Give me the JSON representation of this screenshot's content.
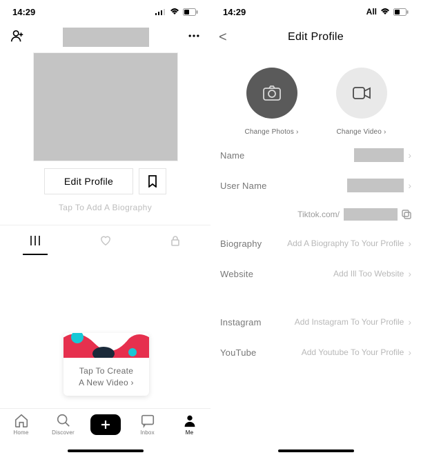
{
  "status": {
    "time": "14:29",
    "right_carrier": "All"
  },
  "left": {
    "edit_profile_btn": "Edit Profile",
    "bio_placeholder": "Tap To Add A Biography",
    "popup_line1": "Tap To Create",
    "popup_line2": "A New Video ›"
  },
  "nav": {
    "home": "Home",
    "discover": "Discover",
    "inbox": "Inbox",
    "me": "Me"
  },
  "right": {
    "title": "Edit Profile",
    "change_photo": "Change Photos ›",
    "change_video": "Change Video ›",
    "name_label": "Name",
    "username_label": "User Name",
    "tiktok_url_prefix": "Tiktok.com/",
    "bio_label": "Biography",
    "bio_value": "Add A Biography To Your Profile",
    "website_label": "Website",
    "website_value": "Add Ill Too Website",
    "instagram_label": "Instagram",
    "instagram_value": "Add Instagram To Your Profile",
    "youtube_label": "YouTube",
    "youtube_value": "Add Youtube To Your Profile"
  }
}
